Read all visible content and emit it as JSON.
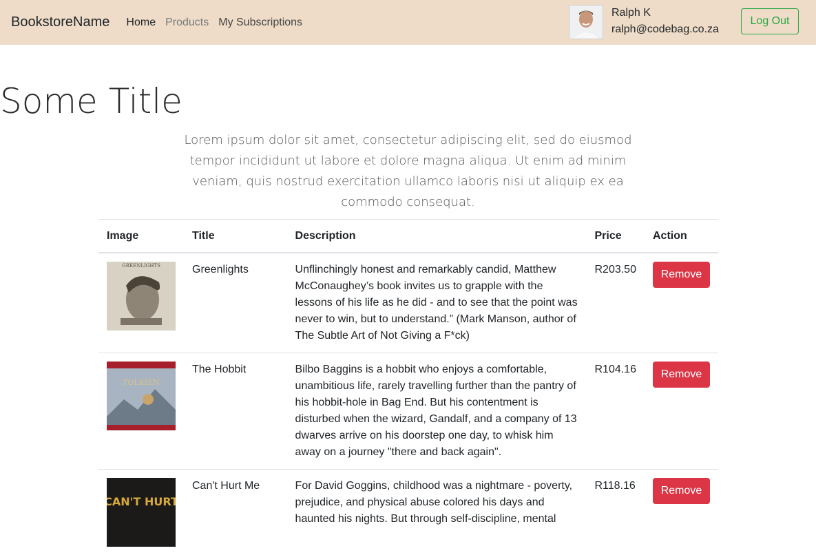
{
  "navbar": {
    "brand": "BookstoreName",
    "links": [
      {
        "label": "Home"
      },
      {
        "label": "Products"
      },
      {
        "label": "My Subscriptions"
      }
    ],
    "user": {
      "name": "Ralph K",
      "email": "ralph@codebag.co.za"
    },
    "logout_label": "Log Out"
  },
  "hero": {
    "title": "Some Title",
    "text": "Lorem ipsum dolor sit amet, consectetur adipiscing elit, sed do eiusmod tempor incididunt ut labore et dolore magna aliqua. Ut enim ad minim veniam, quis nostrud exercitation ullamco laboris nisi ut aliquip ex ea commodo consequat."
  },
  "table": {
    "headers": [
      "Image",
      "Title",
      "Description",
      "Price",
      "Action"
    ],
    "rows": [
      {
        "title": "Greenlights",
        "cover_text": "GREENLIGHTS",
        "description": "Unflinchingly honest and remarkably candid, Matthew McConaughey’s book invites us to grapple with the lessons of his life as he did - and to see that the point was never to win, but to understand.” (Mark Manson, author of The Subtle Art of Not Giving a F*ck)",
        "price": "R203.50",
        "action": "Remove"
      },
      {
        "title": "The Hobbit",
        "cover_text": "TOLKIEN",
        "description": "Bilbo Baggins is a hobbit who enjoys a comfortable, unambitious life, rarely travelling further than the pantry of his hobbit-hole in Bag End. But his contentment is disturbed when the wizard, Gandalf, and a company of 13 dwarves arrive on his doorstep one day, to whisk him away on a journey \"there and back again\".",
        "price": "R104.16",
        "action": "Remove"
      },
      {
        "title": "Can't Hurt Me",
        "cover_text": "CAN'T HURT",
        "description": "For David Goggins, childhood was a nightmare - poverty, prejudice, and physical abuse colored his days and haunted his nights. But through self-discipline, mental",
        "price": "R118.16",
        "action": "Remove"
      }
    ]
  },
  "colors": {
    "navbar_bg": "#eedcc8",
    "remove_button": "#dc3545",
    "logout_outline": "#28a745"
  }
}
